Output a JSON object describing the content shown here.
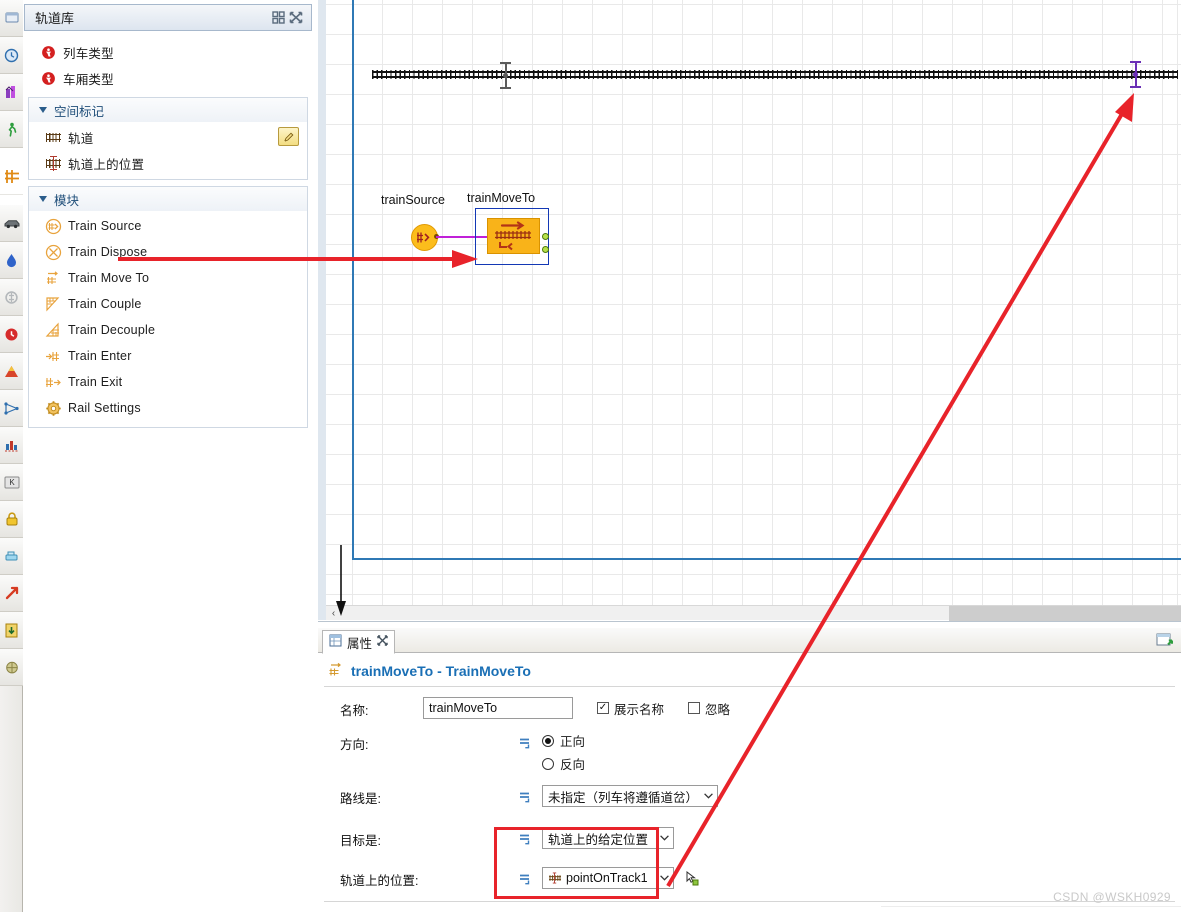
{
  "left_rail": {
    "items": [
      {
        "name": "rail-icon-presentation",
        "glyph": "▣"
      },
      {
        "name": "rail-icon-clock",
        "glyph": "🕐"
      },
      {
        "name": "rail-icon-chart",
        "glyph": "📊"
      },
      {
        "name": "rail-icon-pedestrian",
        "glyph": "🚶"
      },
      {
        "name": "rail-icon-rail-library",
        "glyph": "#"
      },
      {
        "name": "rail-icon-road-traffic",
        "glyph": "🚗"
      },
      {
        "name": "rail-icon-fluid",
        "glyph": "💧"
      },
      {
        "name": "rail-icon-material-handling",
        "glyph": "⚙"
      },
      {
        "name": "rail-icon-process-modeling",
        "glyph": "●"
      },
      {
        "name": "rail-icon-agent",
        "glyph": "▲"
      },
      {
        "name": "rail-icon-network",
        "glyph": "◆"
      },
      {
        "name": "rail-icon-statistics",
        "glyph": "▥"
      },
      {
        "name": "rail-icon-controls",
        "glyph": "K"
      },
      {
        "name": "rail-icon-security",
        "glyph": "🔒"
      },
      {
        "name": "rail-icon-connectivity",
        "glyph": "▭"
      },
      {
        "name": "rail-icon-analysis",
        "glyph": "↗"
      },
      {
        "name": "rail-icon-import",
        "glyph": "⬇"
      },
      {
        "name": "rail-icon-3d-objects",
        "glyph": "⬤"
      }
    ]
  },
  "library": {
    "title": "轨道库",
    "header_buttons": [
      {
        "name": "restore-panel-icon",
        "tooltip": "还原"
      },
      {
        "name": "maximize-panel-icon",
        "tooltip": "最大化"
      }
    ],
    "top_items": [
      {
        "label": "列车类型",
        "icon": "train-type-icon"
      },
      {
        "label": "车厢类型",
        "icon": "car-type-icon"
      }
    ],
    "groups": [
      {
        "title": "空间标记",
        "items": [
          {
            "label": "轨道",
            "icon": "track-icon",
            "has_edit": true
          },
          {
            "label": "轨道上的位置",
            "icon": "point-on-track-icon",
            "has_edit": false
          }
        ]
      },
      {
        "title": "模块",
        "items": [
          {
            "label": "Train Source",
            "icon": "train-source-icon"
          },
          {
            "label": "Train Dispose",
            "icon": "train-dispose-icon"
          },
          {
            "label": "Train Move To",
            "icon": "train-move-to-icon"
          },
          {
            "label": "Train Couple",
            "icon": "train-couple-icon"
          },
          {
            "label": "Train Decouple",
            "icon": "train-decouple-icon"
          },
          {
            "label": "Train Enter",
            "icon": "train-enter-icon"
          },
          {
            "label": "Train Exit",
            "icon": "train-exit-icon"
          },
          {
            "label": "Rail Settings",
            "icon": "rail-settings-icon"
          }
        ]
      }
    ]
  },
  "canvas": {
    "blocks": [
      {
        "name": "trainSource",
        "label": "trainSource"
      },
      {
        "name": "trainMoveTo",
        "label": "trainMoveTo",
        "selected": true
      }
    ],
    "track_markers": [
      {
        "name": "track-stop-marker",
        "color": "#5a5a5a"
      },
      {
        "name": "point-on-track-marker",
        "color": "#6a2fb5"
      }
    ],
    "scroll": {
      "left_arrow": "‹"
    }
  },
  "properties": {
    "tab_label": "属性",
    "tab_close": "✕",
    "maximize_icon": "maximize-properties-icon",
    "title": "trainMoveTo - TrainMoveTo",
    "fields": {
      "name_label": "名称:",
      "name_value": "trainMoveTo",
      "show_name_label": "展示名称",
      "show_name_checked": true,
      "ignore_label": "忽略",
      "ignore_checked": false,
      "direction_label": "方向:",
      "direction_forward": "正向",
      "direction_backward": "反向",
      "direction_selected": "正向",
      "route_label": "路线是:",
      "route_value": "未指定（列车将遵循道岔）",
      "target_label": "目标是:",
      "target_value": "轨道上的给定位置",
      "point_label": "轨道上的位置:",
      "point_value": "pointOnTrack1",
      "dropdown_arrow": "⌄"
    }
  },
  "annotations": {
    "arrow_color": "#e8232a",
    "highlight_color": "#e8232a"
  },
  "watermark": "CSDN @WSKH0929"
}
